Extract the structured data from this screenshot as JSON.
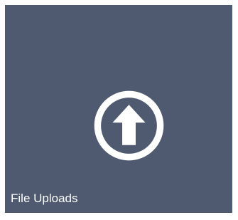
{
  "tile": {
    "label": "File Uploads",
    "icon": "upload-arrow-circle-icon",
    "background_color": "#4f5a71",
    "icon_color": "#ffffff",
    "label_color": "#ffffff"
  }
}
